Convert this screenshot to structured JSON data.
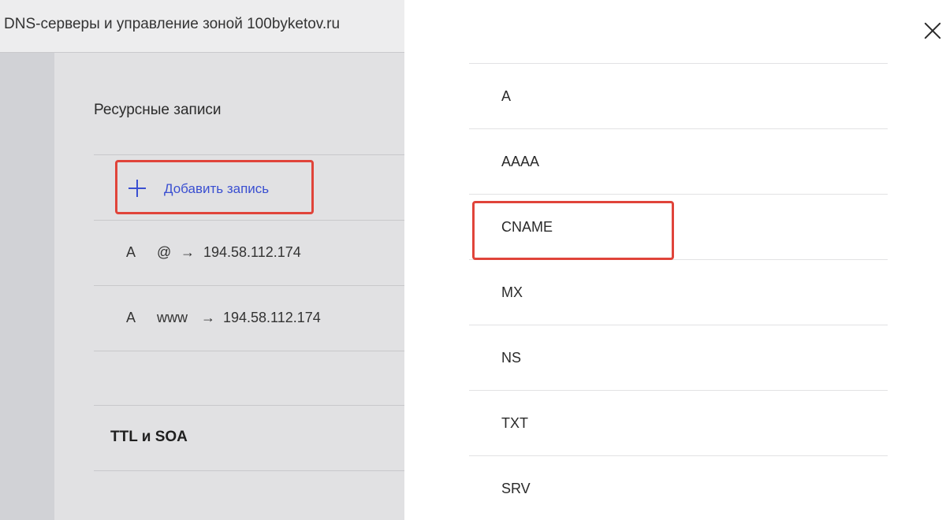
{
  "header": {
    "title": "DNS-серверы и управление зоной 100byketov.ru"
  },
  "resource_records": {
    "title": "Ресурсные записи",
    "add_button_label": "Добавить запись",
    "records": [
      {
        "type": "A",
        "name": "@",
        "arrow": "→",
        "value": "194.58.112.174"
      },
      {
        "type": "A",
        "name": "www",
        "arrow": "→",
        "value": "194.58.112.174"
      }
    ]
  },
  "ttl_section": {
    "title": "TTL и SOA"
  },
  "drawer": {
    "record_types": [
      {
        "label": "A"
      },
      {
        "label": "AAAA"
      },
      {
        "label": "CNAME",
        "highlighted": true
      },
      {
        "label": "MX"
      },
      {
        "label": "NS"
      },
      {
        "label": "TXT"
      },
      {
        "label": "SRV"
      }
    ]
  },
  "colors": {
    "accent": "#3a4fd1",
    "highlight_border": "#e0443a"
  }
}
